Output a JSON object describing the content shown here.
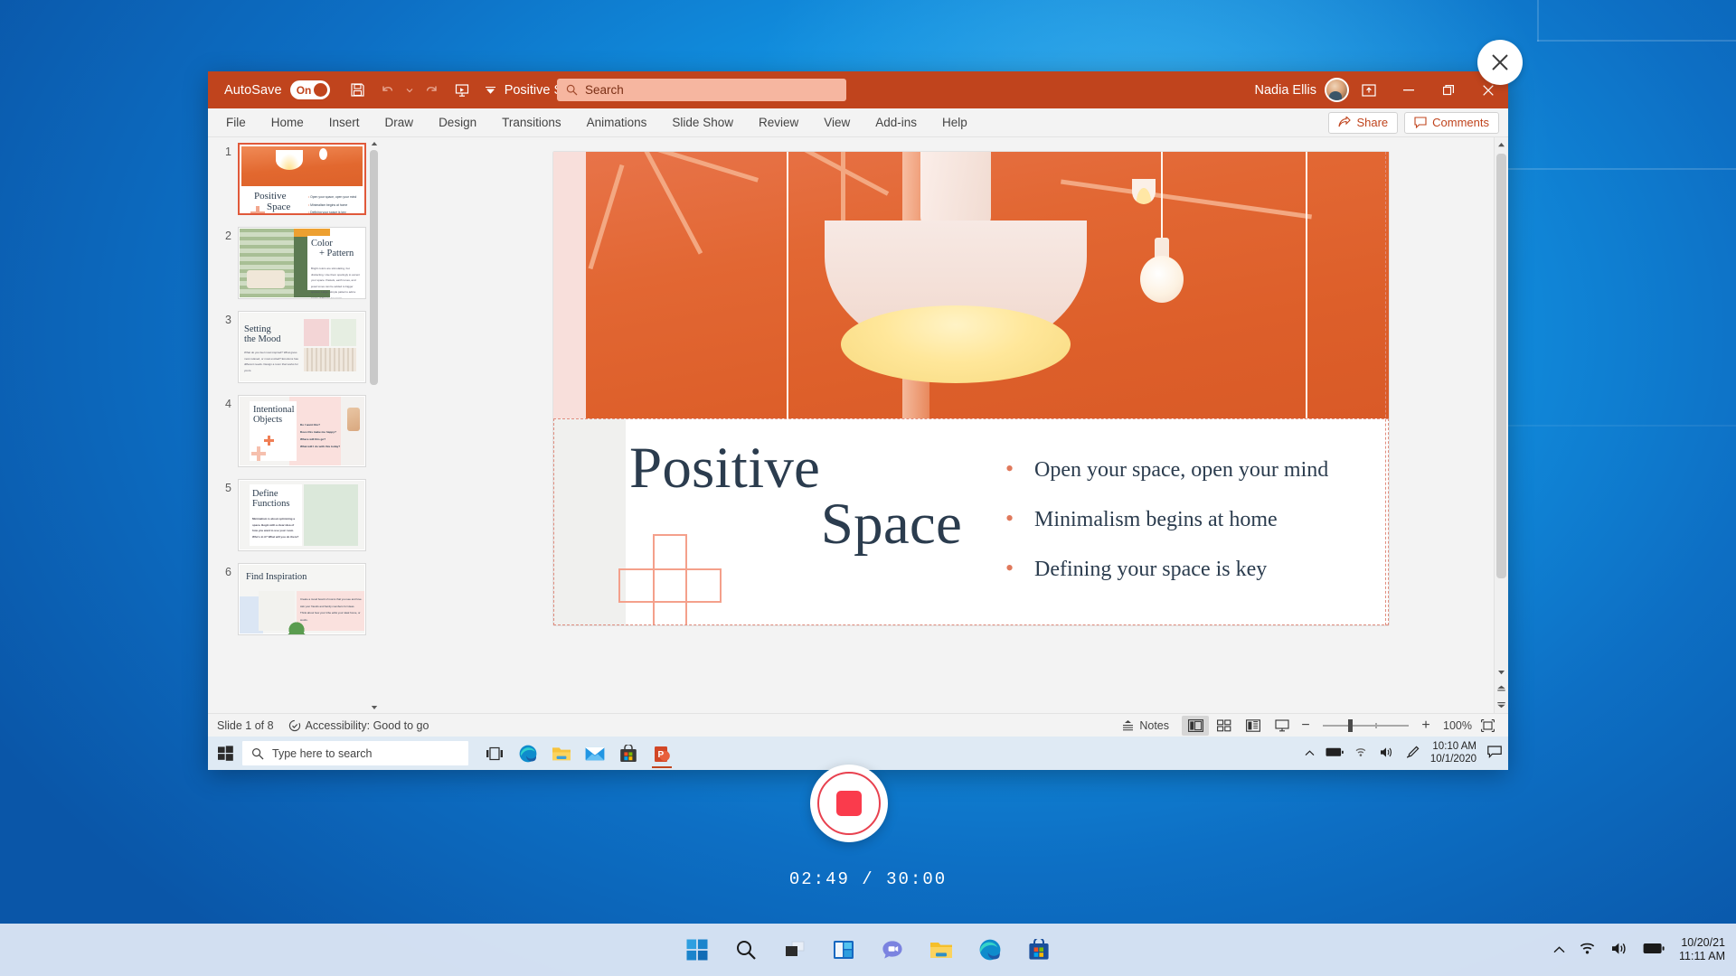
{
  "app": {
    "name": "Microsoft PowerPoint",
    "autosave_label": "AutoSave",
    "autosave_state": "On",
    "document_title": "Positive Space – Saved to OneDrive",
    "user_name": "Nadia Ellis",
    "accent_color": "#c0441d"
  },
  "search": {
    "placeholder": "Search",
    "value": ""
  },
  "quick_access": [
    {
      "name": "save",
      "label": "Save"
    },
    {
      "name": "undo",
      "label": "Undo"
    },
    {
      "name": "redo",
      "label": "Redo"
    },
    {
      "name": "start-from-beginning",
      "label": "Start From Beginning"
    }
  ],
  "window_controls": [
    {
      "name": "ribbon-display-options",
      "label": "Ribbon Display Options"
    },
    {
      "name": "minimize",
      "label": "Minimize"
    },
    {
      "name": "restore",
      "label": "Restore Down"
    },
    {
      "name": "close",
      "label": "Close"
    }
  ],
  "ribbon": {
    "tabs": [
      {
        "label": "File"
      },
      {
        "label": "Home"
      },
      {
        "label": "Insert"
      },
      {
        "label": "Draw"
      },
      {
        "label": "Design"
      },
      {
        "label": "Transitions"
      },
      {
        "label": "Animations"
      },
      {
        "label": "Slide Show"
      },
      {
        "label": "Review"
      },
      {
        "label": "View"
      },
      {
        "label": "Add-ins"
      },
      {
        "label": "Help"
      }
    ],
    "share_label": "Share",
    "comments_label": "Comments"
  },
  "thumbnails": [
    {
      "number": "1",
      "title": "Positive Space",
      "selected": true,
      "bullets": [
        "Open your space, open your mind",
        "Minimalism begins at home",
        "Defining your space is key"
      ]
    },
    {
      "number": "2",
      "title": "Color + Pattern",
      "selected": false,
      "body": "Bright colors are stimulating, but distracting. Use them sparingly to accent your space. Pastels, earth tones, and jewel tones can be added to bigger spaces. Large, simple patterns add a sense of flow to any room."
    },
    {
      "number": "3",
      "title": "Setting the Mood",
      "selected": false,
      "body": "What do you feel most inspired? What gives most relaxed, or most excited? Emotions has different needs. Design a room that works for yours."
    },
    {
      "number": "4",
      "title": "Intentional Objects",
      "selected": false,
      "bullets": [
        "Do I want this?",
        "Does this make me happy?",
        "Where will this go?",
        "What will I do with this today?"
      ]
    },
    {
      "number": "5",
      "title": "Define Functions",
      "selected": false,
      "body": "Minimalism is about optimizing a space. Begin with a clear idea of how you want to use your room. Who's in it? What will you do there?"
    },
    {
      "number": "6",
      "title": "Find Inspiration",
      "selected": false,
      "bullets": [
        "Create a mood board of rooms that you see and love.",
        "Ask your friends and family members for ideas.",
        "Think about how your tribe edits your ideal home, or words."
      ]
    }
  ],
  "slide": {
    "title_line1": "Positive",
    "title_line2": "Space",
    "bullets": [
      "Open your space, open your mind",
      "Minimalism begins at home",
      "Defining your space is key"
    ],
    "title_color": "#2b3c4e",
    "accent_color": "#e0795c"
  },
  "status_bar": {
    "slide_counter": "Slide 1 of 8",
    "accessibility": "Accessibility: Good to go",
    "notes_label": "Notes",
    "views": [
      {
        "name": "normal-view",
        "label": "Normal",
        "active": true
      },
      {
        "name": "slide-sorter-view",
        "label": "Slide Sorter",
        "active": false
      },
      {
        "name": "reading-view",
        "label": "Reading View",
        "active": false
      },
      {
        "name": "slide-show-view",
        "label": "Slide Show",
        "active": false
      }
    ],
    "zoom_out_label": "−",
    "zoom_in_label": "+",
    "zoom_level": "100%",
    "fit_label": "Fit slide to current window"
  },
  "inner_taskbar": {
    "search_placeholder": "Type here to search",
    "apps": [
      {
        "name": "task-view",
        "label": "Task View"
      },
      {
        "name": "edge",
        "label": "Microsoft Edge"
      },
      {
        "name": "file-explorer",
        "label": "File Explorer"
      },
      {
        "name": "mail",
        "label": "Mail"
      },
      {
        "name": "microsoft-store",
        "label": "Microsoft Store"
      },
      {
        "name": "powerpoint",
        "label": "PowerPoint"
      }
    ],
    "clock_time": "10:10 AM",
    "clock_date": "10/1/2020"
  },
  "recording": {
    "elapsed": "02:49",
    "total": "30:00",
    "separator": "/",
    "stop_label": "Stop recording",
    "close_label": "Close"
  },
  "outer_taskbar": {
    "apps": [
      {
        "name": "start",
        "label": "Start"
      },
      {
        "name": "search",
        "label": "Search"
      },
      {
        "name": "task-view",
        "label": "Task View"
      },
      {
        "name": "widgets",
        "label": "Widgets"
      },
      {
        "name": "chat",
        "label": "Chat"
      },
      {
        "name": "file-explorer",
        "label": "File Explorer"
      },
      {
        "name": "edge",
        "label": "Microsoft Edge"
      },
      {
        "name": "microsoft-store",
        "label": "Microsoft Store"
      }
    ],
    "clock_date": "10/20/21",
    "clock_time": "11:11 AM"
  }
}
